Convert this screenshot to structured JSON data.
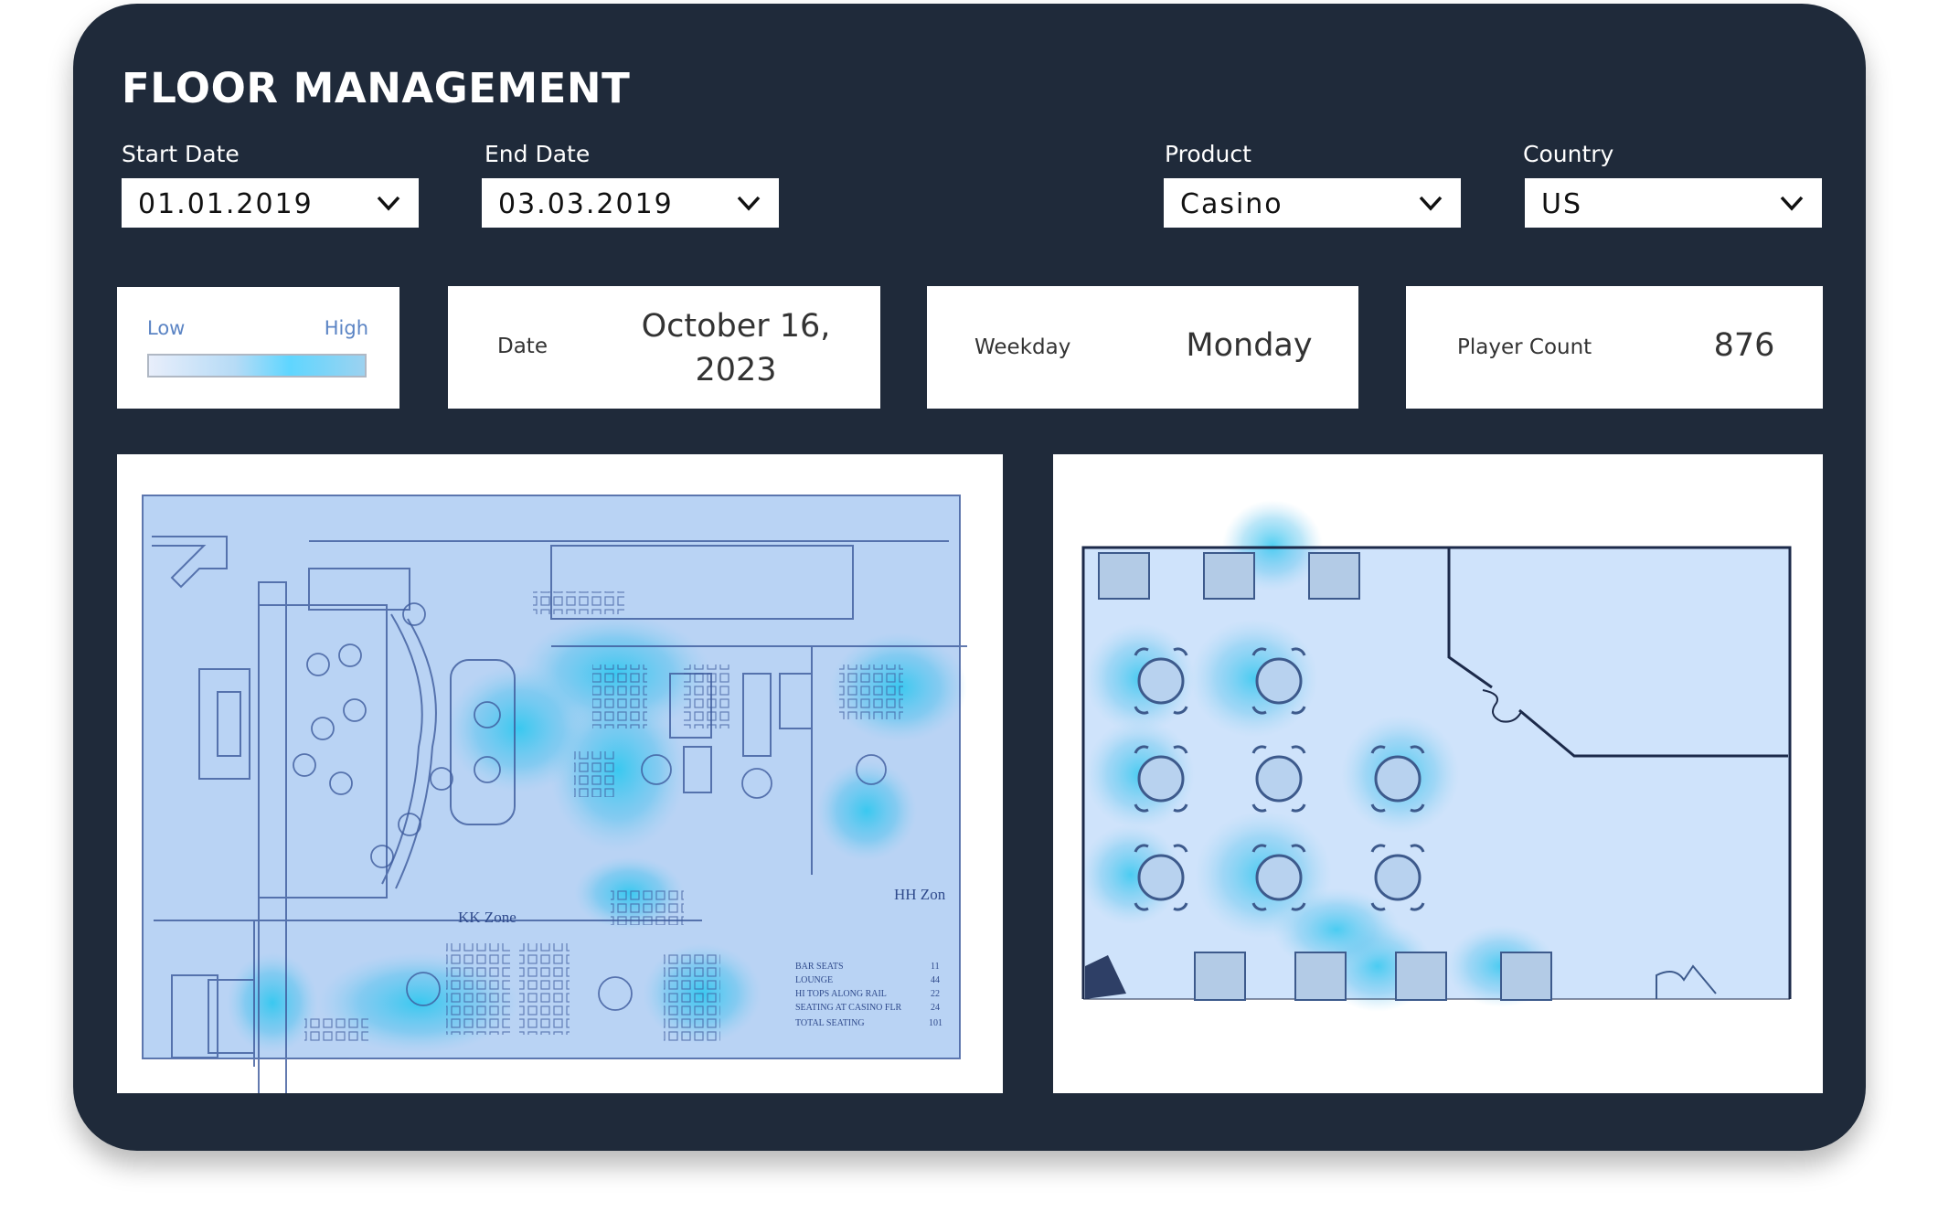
{
  "header": {
    "title": "FLOOR MANAGEMENT"
  },
  "filters": {
    "start_date": {
      "label": "Start Date",
      "value": "01.01.2019"
    },
    "end_date": {
      "label": "End Date",
      "value": "03.03.2019"
    },
    "product": {
      "label": "Product",
      "value": "Casino"
    },
    "country": {
      "label": "Country",
      "value": "US"
    }
  },
  "legend": {
    "low": "Low",
    "high": "High"
  },
  "kpis": {
    "date": {
      "label": "Date",
      "value": "October 16, 2023"
    },
    "weekday": {
      "label": "Weekday",
      "value": "Monday"
    },
    "player_count": {
      "label": "Player Count",
      "value": "876"
    }
  },
  "floorplan_left": {
    "zones": [
      "KK Zone",
      "HH Zon"
    ],
    "seating_legend": [
      {
        "label": "BAR SEATS",
        "count": "11"
      },
      {
        "label": "LOUNGE",
        "count": "44"
      },
      {
        "label": "HI TOPS ALONG RAIL",
        "count": "22"
      },
      {
        "label": "SEATING AT CASINO FLR",
        "count": "24"
      },
      {
        "label": "TOTAL SEATING",
        "count": "101"
      }
    ]
  },
  "colors": {
    "background": "#1f2a3a",
    "heat_low": "#e8eefb",
    "heat_high": "#5fd6ff",
    "legend_text": "#5b84c4"
  },
  "icons": {
    "dropdown": "chevron-down-icon"
  }
}
